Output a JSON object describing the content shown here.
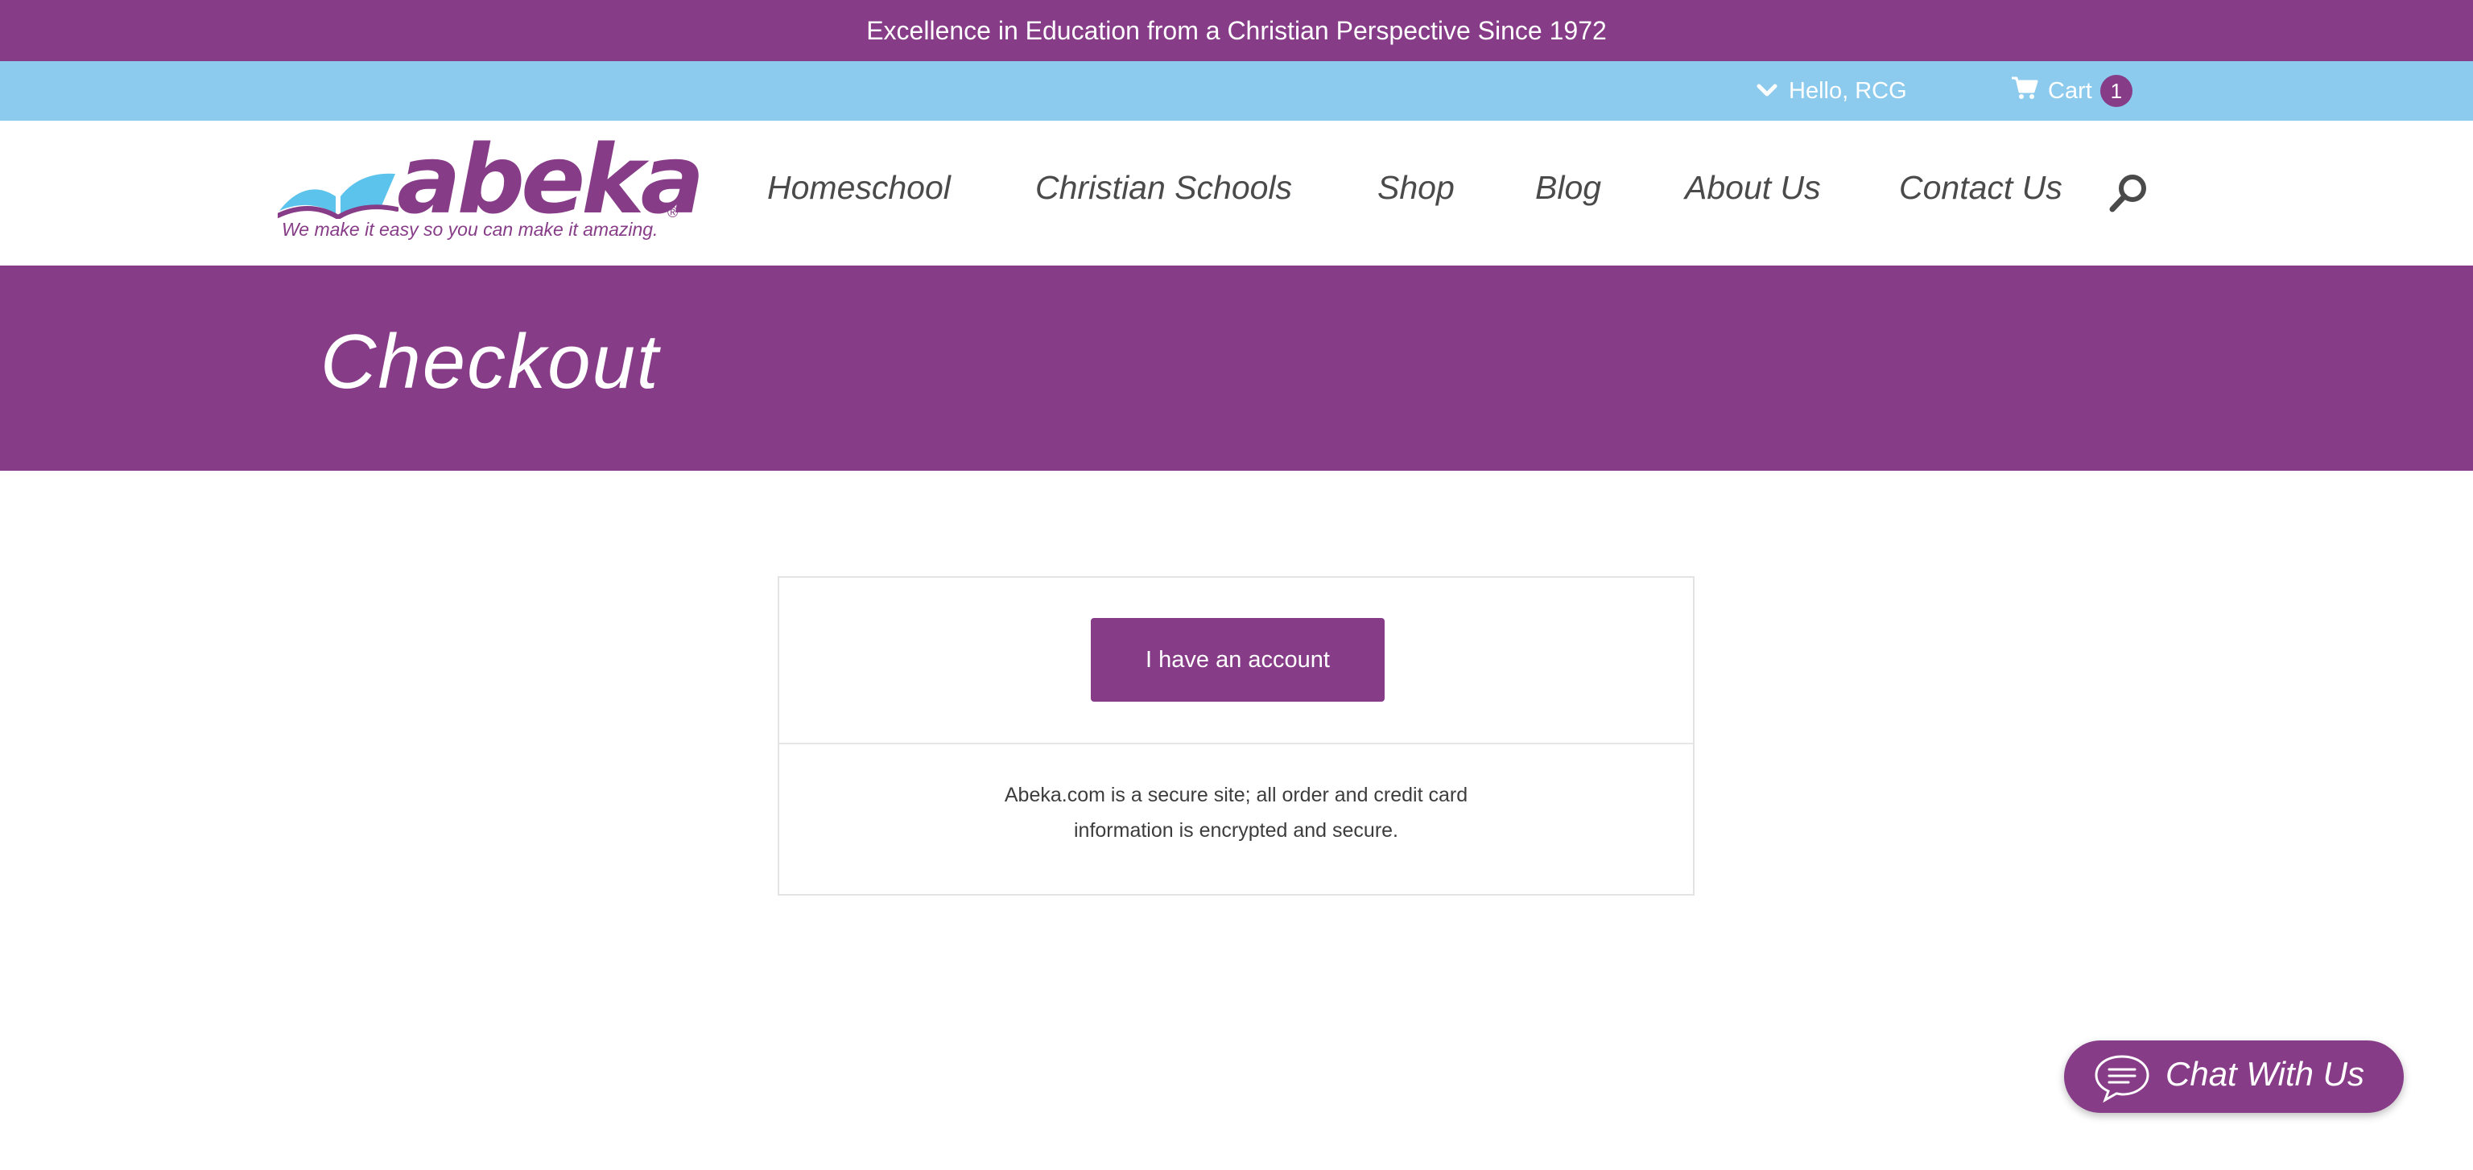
{
  "banner": {
    "text": "Excellence in Education from a Christian Perspective Since 1972"
  },
  "account_bar": {
    "greeting": "Hello, RCG",
    "cart_label": "Cart",
    "cart_count": "1"
  },
  "logo": {
    "wordmark": "abeka",
    "registered": "®",
    "tagline": "We make it easy so you can make it amazing."
  },
  "nav": {
    "items": [
      "Homeschool",
      "Christian Schools",
      "Shop",
      "Blog",
      "About Us",
      "Contact Us"
    ]
  },
  "hero": {
    "title": "Checkout"
  },
  "checkout": {
    "account_button": "I have an account",
    "secure_line1": "Abeka.com is a secure site; all order and credit card",
    "secure_line2": "information is encrypted and secure."
  },
  "chat": {
    "label": "Chat With Us"
  },
  "colors": {
    "brand_purple": "#873c88",
    "light_blue": "#8ccbed",
    "logo_blue": "#5cc3ec"
  },
  "icons": [
    "chevron-down-icon",
    "cart-icon",
    "search-icon",
    "chat-bubble-icon",
    "open-book-logo-icon"
  ]
}
